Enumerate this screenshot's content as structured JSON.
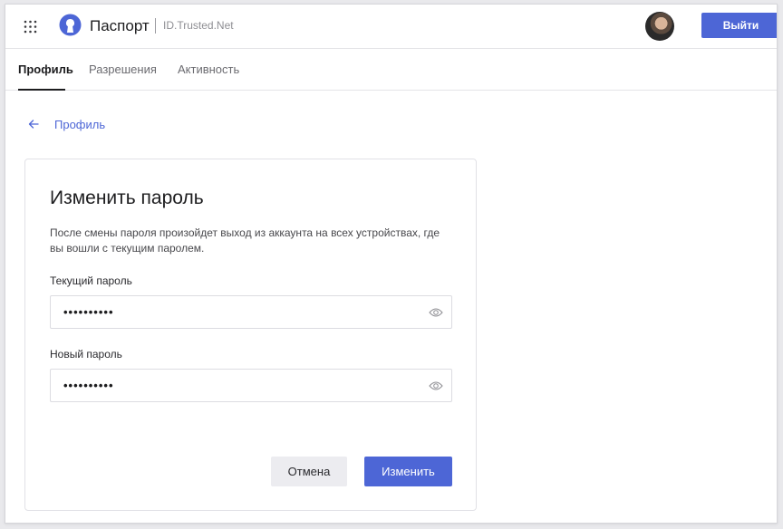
{
  "header": {
    "app_name": "Паспорт",
    "app_domain": "ID.Trusted.Net",
    "logout_label": "Выйти",
    "icons": {
      "apps": "grid-dots-icon",
      "logo": "keyhole-logo-icon"
    }
  },
  "tabs": [
    {
      "label": "Профиль",
      "active": true
    },
    {
      "label": "Разрешения",
      "active": false
    },
    {
      "label": "Активность",
      "active": false
    }
  ],
  "breadcrumb": {
    "back_label": "Профиль"
  },
  "form": {
    "title": "Изменить пароль",
    "description": "После смены пароля произойдет выход из аккаунта на всех устройствах, где вы вошли с текущим паролем.",
    "current_password": {
      "label": "Текущий пароль",
      "value": "••••••••••"
    },
    "new_password": {
      "label": "Новый пароль",
      "value": "••••••••••"
    },
    "cancel_label": "Отмена",
    "submit_label": "Изменить"
  },
  "colors": {
    "accent": "#4d66d6",
    "text": "#1d1d1f",
    "muted": "#8e8e93"
  }
}
